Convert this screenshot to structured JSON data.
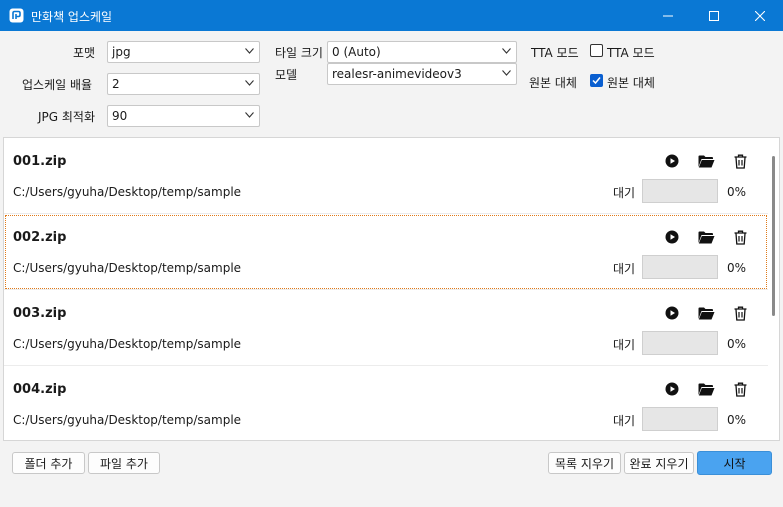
{
  "window": {
    "title": "만화책 업스케일"
  },
  "options": {
    "format_label": "포맷",
    "format_value": "jpg",
    "scale_label": "업스케일 배율",
    "scale_value": "2",
    "jpg_label": "JPG 최적화",
    "jpg_value": "90",
    "tile_label": "타일 크기",
    "tile_value": "0 (Auto)",
    "model_label": "모델",
    "model_value": "realesr-animevideov3",
    "tta_label": "TTA 모드",
    "tta_check_label": "TTA 모드",
    "tta_checked": false,
    "replace_label": "원본 대체",
    "replace_check_label": "원본 대체",
    "replace_checked": true
  },
  "items": [
    {
      "name": "001.zip",
      "path": "C:/Users/gyuha/Desktop/temp/sample",
      "status": "대기",
      "percent": "0%",
      "progress": 0
    },
    {
      "name": "002.zip",
      "path": "C:/Users/gyuha/Desktop/temp/sample",
      "status": "대기",
      "percent": "0%",
      "progress": 0
    },
    {
      "name": "003.zip",
      "path": "C:/Users/gyuha/Desktop/temp/sample",
      "status": "대기",
      "percent": "0%",
      "progress": 0
    },
    {
      "name": "004.zip",
      "path": "C:/Users/gyuha/Desktop/temp/sample",
      "status": "대기",
      "percent": "0%",
      "progress": 0
    }
  ],
  "buttons": {
    "add_folder": "폴더 추가",
    "add_file": "파일 추가",
    "clear_list": "목록 지우기",
    "clear_done": "완료 지우기",
    "start": "시작"
  },
  "colors": {
    "titlebar": "#0a78d4",
    "accent": "#0a5fd0",
    "start_button": "#4aa3f0",
    "focus_outline": "#e07a1a"
  }
}
